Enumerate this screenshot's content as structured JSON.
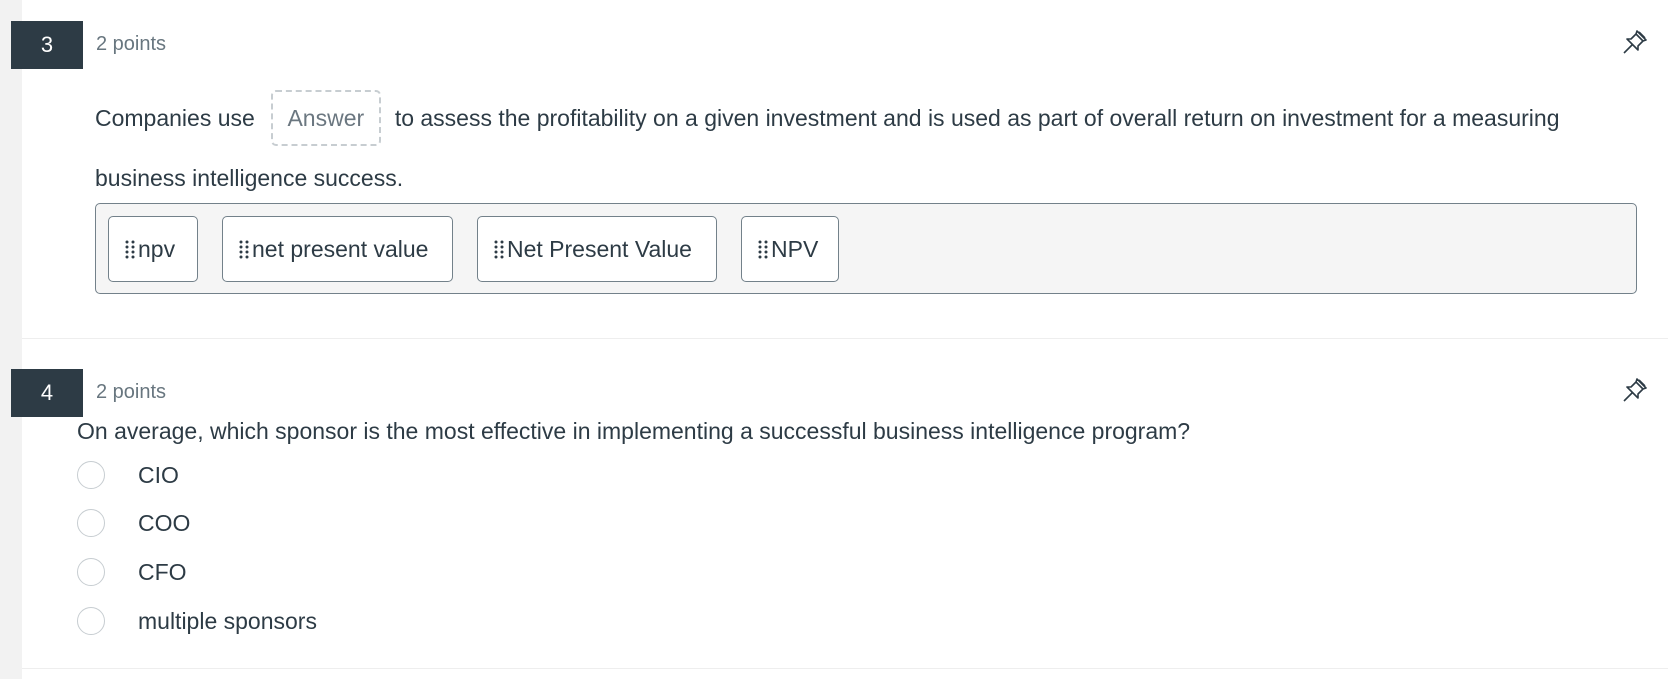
{
  "questions": [
    {
      "number": "3",
      "points": "2 points",
      "type": "fill-in-blank-drag",
      "text_before": "Companies use",
      "blank_placeholder": "Answer",
      "text_after": "to assess the profitability on a given investment and is used as part of overall return on investment for a measuring business intelligence success.",
      "answer_bank": [
        "npv",
        "net present value",
        "Net Present Value",
        "NPV"
      ],
      "pin_icon": "pushpin-icon"
    },
    {
      "number": "4",
      "points": "2 points",
      "type": "multiple-choice",
      "text": "On average, which sponsor is the most effective in implementing a successful business intelligence program?",
      "options": [
        "CIO",
        "COO",
        "CFO",
        "multiple sponsors"
      ],
      "selected": null,
      "pin_icon": "pushpin-icon"
    }
  ],
  "colors": {
    "badge_bg": "#2d3b45",
    "text": "#2d3b45",
    "muted": "#68767f",
    "bank_bg": "#f5f5f5",
    "border": "#73818a"
  }
}
